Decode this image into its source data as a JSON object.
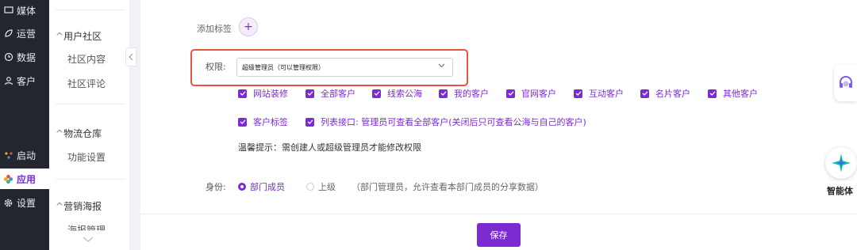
{
  "nav": {
    "items": [
      {
        "label": "媒体",
        "icon": "screen-icon"
      },
      {
        "label": "运营",
        "icon": "leaf-icon"
      },
      {
        "label": "数据",
        "icon": "clock-icon"
      },
      {
        "label": "客户",
        "icon": "user-icon"
      },
      {
        "label": "启动",
        "icon": "dots-icon"
      },
      {
        "label": "应用",
        "icon": "flower-icon"
      },
      {
        "label": "设置",
        "icon": "gear-icon"
      }
    ],
    "active": "应用"
  },
  "submenu": {
    "groups": [
      {
        "title": "用户社区",
        "items": [
          "社区内容",
          "社区评论"
        ]
      },
      {
        "title": "物流仓库",
        "items": [
          "功能设置"
        ]
      },
      {
        "title": "营销海报",
        "items": [
          "海报管理"
        ]
      }
    ]
  },
  "form": {
    "add_tag_label": "添加标签",
    "perm_label": "权限:",
    "perm_value": "超级管理员（可以管理权限）",
    "permissions": [
      "网站装修",
      "全部客户",
      "线索公海",
      "我的客户",
      "官网客户",
      "互动客户",
      "名片客户",
      "其他客户",
      "客户标签",
      "列表接口: 管理员可查看全部客户(关闭后只可查看公海与自己的客户)"
    ],
    "tip": "温馨提示：需创建人或超级管理员才能修改权限",
    "identity_label": "身份:",
    "identity_options": [
      "部门成员",
      "上级"
    ],
    "identity_selected": "部门成员",
    "identity_desc": "（部门管理员，允许查看本部门成员的分享数据）"
  },
  "footer": {
    "save_label": "保存"
  },
  "floating": {
    "agent_label": "智能体"
  },
  "colors": {
    "accent": "#7a2bd1",
    "highlight": "#e5553f",
    "nav_bg": "#23262e"
  }
}
